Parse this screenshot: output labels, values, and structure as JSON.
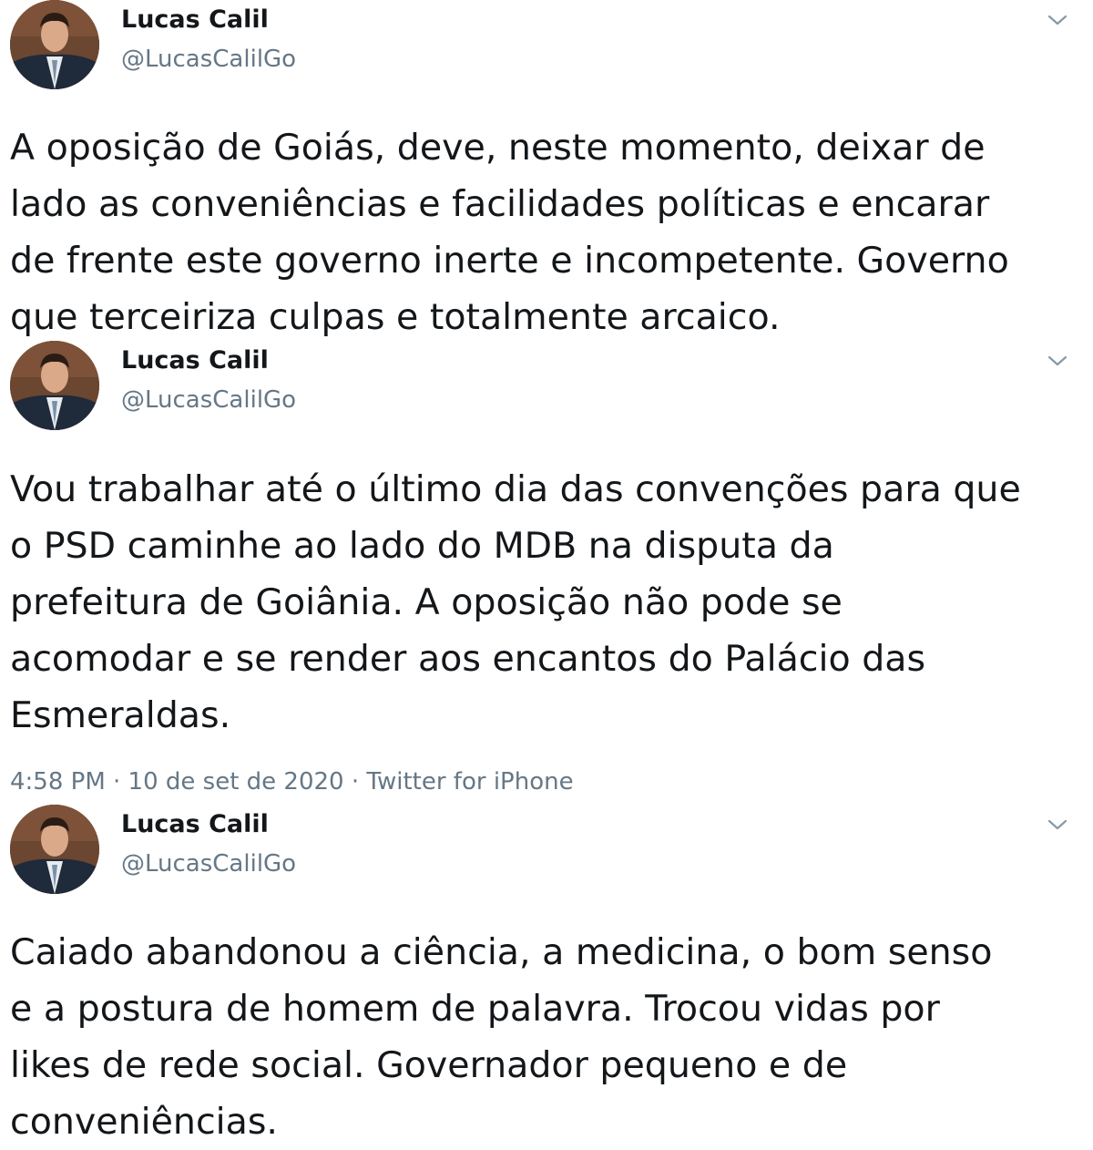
{
  "tweets": [
    {
      "author_name": "Lucas Calil",
      "author_handle": "@LucasCalilGo",
      "text": "A oposição de Goiás, deve, neste momento, deixar de\nlado as conveniências e facilidades políticas e encarar\nde frente este governo inerte e incompetente. Governo\nque terceiriza culpas e totalmente arcaico."
    },
    {
      "author_name": "Lucas Calil",
      "author_handle": "@LucasCalilGo",
      "text": "Vou trabalhar até o último dia das convenções para que\no PSD caminhe ao lado do MDB na disputa da\nprefeitura de Goiânia. A oposição não pode se\nacomodar e se render aos encantos do Palácio das\nEsmeraldas.",
      "meta": "4:58 PM · 10 de set de 2020 · Twitter for iPhone"
    },
    {
      "author_name": "Lucas Calil",
      "author_handle": "@LucasCalilGo",
      "text": "Caiado abandonou a ciência, a medicina, o bom senso\ne a postura de homem de palavra.  Trocou vidas por\nlikes de rede social. Governador pequeno e de\nconveniências."
    }
  ],
  "icons": {
    "avatar": "profile-photo",
    "chevron": "chevron-down-icon"
  },
  "colors": {
    "text_primary": "#14171a",
    "text_secondary": "#657786",
    "chevron": "#8899a6"
  }
}
